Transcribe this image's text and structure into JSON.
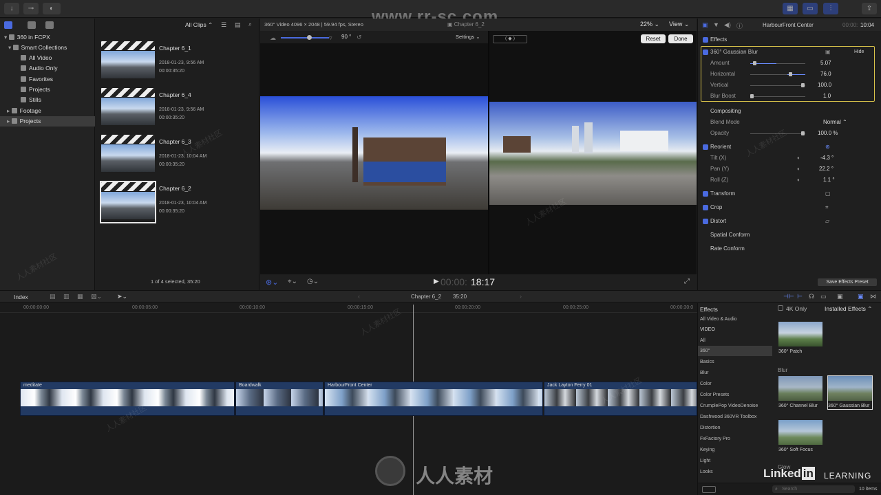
{
  "watermark": {
    "top_url": "www.rr-sc.com",
    "bottom_brand": "人人素材",
    "repeat": "人人素材社区",
    "learning": "LEARNING",
    "linkedin": "Linked"
  },
  "library": {
    "root": "360 in FCPX",
    "items": [
      {
        "label": "Smart Collections"
      },
      {
        "label": "All Video"
      },
      {
        "label": "Audio Only"
      },
      {
        "label": "Favorites"
      },
      {
        "label": "Projects"
      },
      {
        "label": "Stills"
      },
      {
        "label": "Footage"
      },
      {
        "label": "Projects"
      }
    ]
  },
  "browser": {
    "filter": "All Clips",
    "footer": "1 of 4 selected, 35:20",
    "clips": [
      {
        "title": "Chapter 6_1",
        "date": "2018-01-23, 9:56 AM",
        "dur": "00:00:35:20"
      },
      {
        "title": "Chapter 6_4",
        "date": "2018-01-23, 9:56 AM",
        "dur": "00:00:35:20"
      },
      {
        "title": "Chapter 6_3",
        "date": "2018-01-23, 10:04 AM",
        "dur": "00:00:35:20"
      },
      {
        "title": "Chapter 6_2",
        "date": "2018-01-23, 10:04 AM",
        "dur": "00:00:35:20"
      }
    ]
  },
  "viewer": {
    "format": "360° Video 4096 × 2048 | 59.94 fps, Stereo",
    "project": "Chapter 6_2",
    "zoom": "22%",
    "view": "View",
    "angle": "90 °",
    "settings": "Settings",
    "reset": "Reset",
    "done": "Done",
    "timecode_dim": "00:00:",
    "timecode": "18:17"
  },
  "inspector": {
    "clip": "HarbourFront Center",
    "time_dim": "00:00:",
    "time": "10:04",
    "effects": "Effects",
    "effect_name": "360° Gaussian Blur",
    "hide": "Hide",
    "params": [
      {
        "label": "Amount",
        "value": "5.07"
      },
      {
        "label": "Horizontal",
        "value": "76.0"
      },
      {
        "label": "Vertical",
        "value": "100.0"
      },
      {
        "label": "Blur Boost",
        "value": "1.0"
      }
    ],
    "compositing": "Compositing",
    "blend_label": "Blend Mode",
    "blend_value": "Normal",
    "opacity_label": "Opacity",
    "opacity_value": "100.0 %",
    "reorient": "Reorient",
    "reorient_params": [
      {
        "label": "Tilt (X)",
        "value": "-4.3 °"
      },
      {
        "label": "Pan (Y)",
        "value": "22.2 °"
      },
      {
        "label": "Roll (Z)",
        "value": "1.1 °"
      }
    ],
    "transform": "Transform",
    "crop": "Crop",
    "distort": "Distort",
    "spatial": "Spatial Conform",
    "rate": "Rate Conform",
    "save_preset": "Save Effects Preset"
  },
  "timeline": {
    "index": "Index",
    "project": "Chapter 6_2",
    "duration": "35:20",
    "ruler": [
      "00:00:00:00",
      "00:00:05:00",
      "00:00:10:00",
      "00:00:15:00",
      "00:00:20:00",
      "00:00:25:00",
      "00:00:30:0"
    ],
    "clips": [
      "meditate",
      "Boardwalk",
      "HarbourFront Center",
      "Jack Layton Ferry 01"
    ]
  },
  "effects_browser": {
    "title": "Effects",
    "fourk": "4K Only",
    "installed": "Installed Effects",
    "categories": [
      "All Video & Audio",
      "VIDEO",
      "All",
      "360°",
      "Basics",
      "Blur",
      "Color",
      "Color Presets",
      "CrumplePop VideoDenoise",
      "Dashwood 360VR Toolbox",
      "Distortion",
      "FxFactory Pro",
      "Keying",
      "Light",
      "Looks"
    ],
    "items": [
      "360° Patch",
      "360° Channel Blur",
      "360° Gaussian Blur",
      "360° Soft Focus"
    ],
    "section_blur": "Blur",
    "section_glow": "Glow",
    "search": "Search",
    "count": "10 items"
  }
}
